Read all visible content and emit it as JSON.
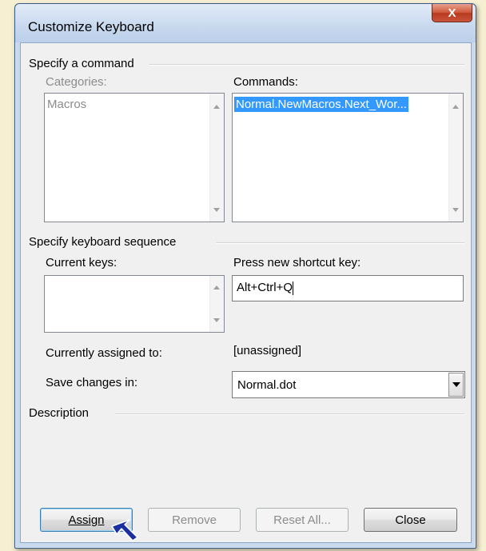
{
  "window": {
    "title": "Customize Keyboard",
    "close_glyph": "X"
  },
  "specify_command": {
    "group_label": "Specify a command",
    "categories_label": "Categories:",
    "categories_items": [
      "Macros"
    ],
    "commands_label": "Commands:",
    "commands_items": [
      "Normal.NewMacros.Next_Wor..."
    ]
  },
  "keyboard_sequence": {
    "group_label": "Specify keyboard sequence",
    "current_keys_label": "Current keys:",
    "press_new_label": "Press new shortcut key:",
    "new_shortcut_value": "Alt+Ctrl+Q",
    "currently_assigned_label": "Currently assigned to:",
    "currently_assigned_value": "[unassigned]",
    "save_changes_label": "Save changes in:",
    "save_changes_value": "Normal.dot"
  },
  "description": {
    "group_label": "Description"
  },
  "buttons": {
    "assign": "Assign",
    "remove": "Remove",
    "reset_all": "Reset All...",
    "close": "Close"
  },
  "colors": {
    "selection": "#3399ff",
    "pointer": "#1a2fa0",
    "close_button": "#c9543a"
  }
}
